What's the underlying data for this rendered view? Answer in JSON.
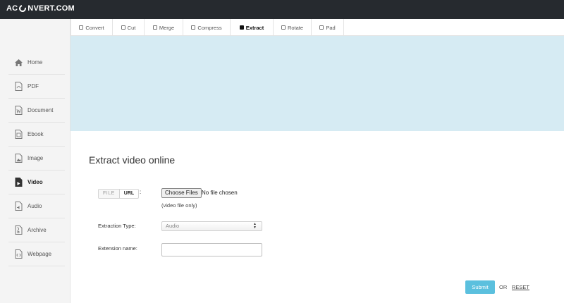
{
  "brand": {
    "logo_left": "AC",
    "logo_right": "NVERT.COM"
  },
  "sidebar": {
    "items": [
      {
        "label": "Home",
        "icon": "home-icon",
        "active": false
      },
      {
        "label": "PDF",
        "icon": "pdf-icon",
        "active": false
      },
      {
        "label": "Document",
        "icon": "document-icon",
        "active": false
      },
      {
        "label": "Ebook",
        "icon": "ebook-icon",
        "active": false
      },
      {
        "label": "Image",
        "icon": "image-icon",
        "active": false
      },
      {
        "label": "Video",
        "icon": "video-icon",
        "active": true
      },
      {
        "label": "Audio",
        "icon": "audio-icon",
        "active": false
      },
      {
        "label": "Archive",
        "icon": "archive-icon",
        "active": false
      },
      {
        "label": "Webpage",
        "icon": "webpage-icon",
        "active": false
      }
    ]
  },
  "tabs": [
    {
      "label": "Convert",
      "active": false
    },
    {
      "label": "Cut",
      "active": false
    },
    {
      "label": "Merge",
      "active": false
    },
    {
      "label": "Compress",
      "active": false
    },
    {
      "label": "Extract",
      "active": true
    },
    {
      "label": "Rotate",
      "active": false
    },
    {
      "label": "Pad",
      "active": false
    }
  ],
  "main": {
    "title": "Extract video online",
    "source_toggle": {
      "file": "FILE",
      "url": "URL",
      "selected": "URL"
    },
    "colon": ":",
    "choose_files": "Choose Files",
    "no_file": "No file chosen",
    "hint": "(video file only)",
    "extraction_type": {
      "label": "Extraction Type:",
      "value": "Audio"
    },
    "extension_name": {
      "label": "Extension name:",
      "value": ""
    },
    "submit": "Submit",
    "or": "OR",
    "reset": "RESET"
  },
  "colors": {
    "topbar": "#262a2f",
    "banner": "#d6ebf3",
    "submit": "#5bc0de",
    "sidebar": "#f4f4f4"
  }
}
